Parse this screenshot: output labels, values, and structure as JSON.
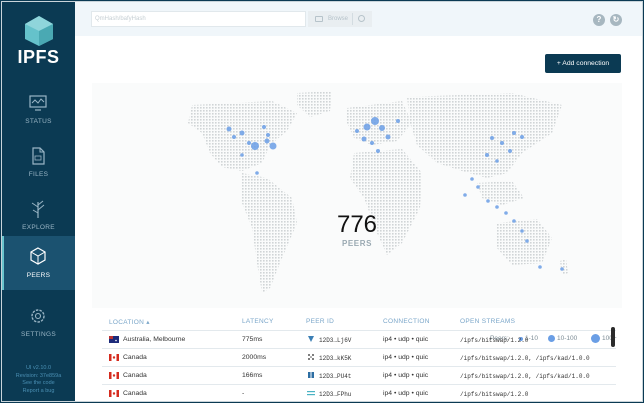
{
  "app": {
    "name": "IPFS"
  },
  "sidebar": {
    "items": [
      {
        "label": "STATUS",
        "icon": "status-monitor-icon"
      },
      {
        "label": "FILES",
        "icon": "files-icon"
      },
      {
        "label": "EXPLORE",
        "icon": "explore-tree-icon"
      },
      {
        "label": "PEERS",
        "icon": "peers-cube-icon",
        "active": true
      },
      {
        "label": "SETTINGS",
        "icon": "settings-gear-icon"
      }
    ],
    "footer": [
      "UI v2.10.0",
      "Revision: 37e859a",
      "See the code",
      "Report a bug"
    ]
  },
  "topbar": {
    "search_placeholder": "QmHash/bafyHash",
    "browse_label": "Browse",
    "help_icon": "help-icon",
    "refresh_icon": "refresh-icon"
  },
  "peers": {
    "add_connection_label": "+ Add connection",
    "count": "776",
    "count_label": "PEERS",
    "legend": {
      "title": "Peers:",
      "small": "1-10",
      "medium": "10-100",
      "large": "100+"
    }
  },
  "table": {
    "headers": {
      "location": "LOCATION ▴",
      "latency": "LATENCY",
      "peer_id": "PEER ID",
      "connection": "CONNECTION",
      "streams": "OPEN STREAMS"
    },
    "rows": [
      {
        "flag": "australia-flag",
        "location": "Australia, Melbourne",
        "latency": "775ms",
        "peer_id": "12D3…Lj6V",
        "connection": "ip4 • udp • quic",
        "streams": "/ipfs/bitswap/1.2.0"
      },
      {
        "flag": "canada-flag",
        "location": "Canada",
        "latency": "2000ms",
        "peer_id": "12D3…kK5K",
        "connection": "ip4 • udp • quic",
        "streams": "/ipfs/bitswap/1.2.0, /ipfs/kad/1.0.0"
      },
      {
        "flag": "canada-flag",
        "location": "Canada",
        "latency": "166ms",
        "peer_id": "12D3…PU4t",
        "connection": "ip4 • udp • quic",
        "streams": "/ipfs/bitswap/1.2.0, /ipfs/kad/1.0.0"
      },
      {
        "flag": "canada-flag",
        "location": "Canada",
        "latency": "-",
        "peer_id": "12D3…FPhu",
        "connection": "ip4 • udp • quic",
        "streams": "/ipfs/bitswap/1.2.0"
      }
    ]
  },
  "colors": {
    "sidebar": "#0b3a53",
    "accent": "#69c4cd",
    "dot": "#6a9ee5"
  }
}
